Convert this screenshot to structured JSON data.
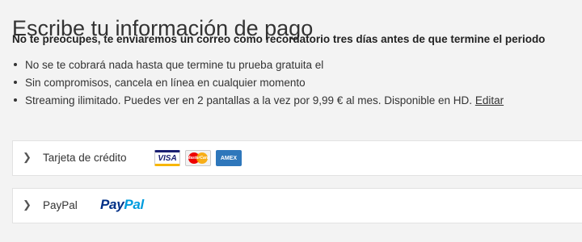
{
  "page": {
    "title": "Escribe tu información de pago",
    "subtitle": "No te preocupes, te enviaremos un correo como recordatorio tres días antes de que termine el periodo",
    "bullets": [
      "No se te cobrará nada hasta que termine tu prueba gratuita el",
      "Sin compromisos, cancela en línea en cualquier momento",
      "Streaming ilimitado. Puedes ver en 2 pantallas a la vez por 9,99 € al mes. Disponible en HD."
    ],
    "edit_link": "Editar"
  },
  "payment_options": {
    "credit_card": {
      "chevron": "❯",
      "label": "Tarjeta de crédito",
      "cards": {
        "visa": "VISA",
        "mastercard": "MasterCard",
        "amex": "AMEX"
      }
    },
    "paypal": {
      "chevron": "❯",
      "label": "PayPal",
      "logo_part1": "Pay",
      "logo_part2": "Pal"
    }
  },
  "colors": {
    "background": "#f3f3f3",
    "paypal_dark": "#003087",
    "paypal_light": "#009cde",
    "amex_blue": "#2e77bb",
    "visa_blue": "#1a1f71"
  }
}
